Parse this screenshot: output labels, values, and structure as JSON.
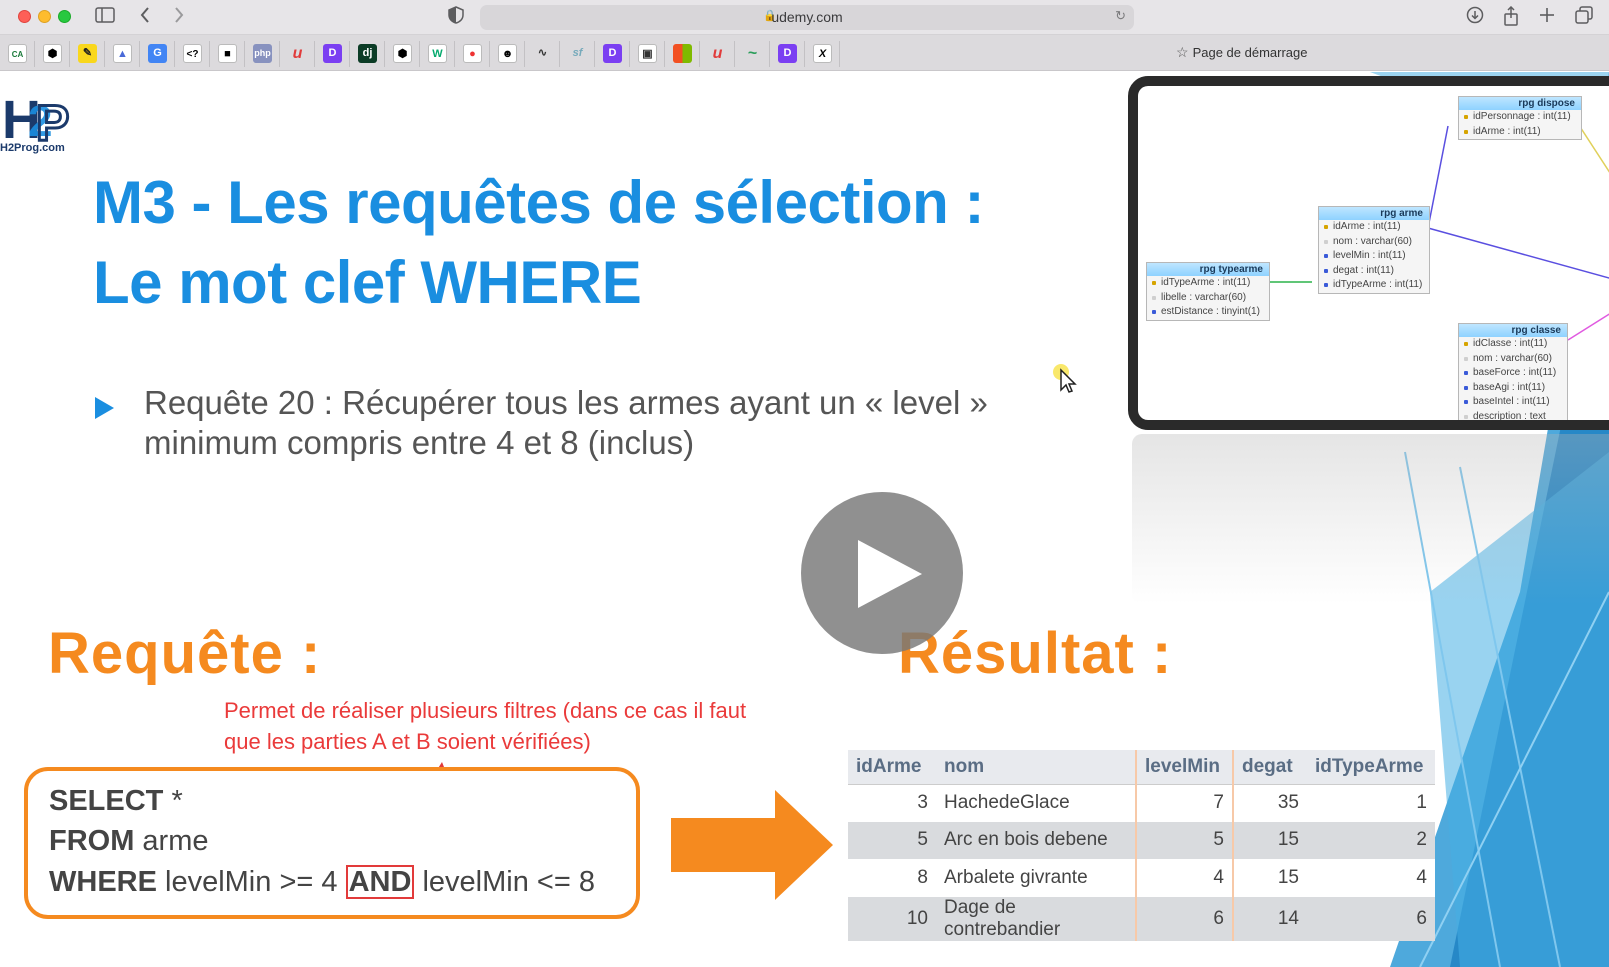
{
  "browser": {
    "url": "udemy.com",
    "start_page_label": "Page de démarrage",
    "favorites": [
      "CA",
      "codepen",
      "pencil",
      "uni",
      "G",
      "<?",
      "ceb",
      "php",
      "u",
      "D",
      "dj",
      "codepen",
      "W",
      "rec",
      "alien",
      "pulse",
      "sf",
      "D",
      "box",
      "ms",
      "u",
      "wave",
      "D",
      "X"
    ]
  },
  "slide": {
    "logo_text": "H2Prog.com",
    "title_line1": "M3 - Les requêtes de sélection :",
    "title_line2": "Le mot clef WHERE",
    "request_line1": "Requête 20 : Récupérer tous les armes ayant un « level »",
    "request_line2": "minimum compris entre 4 et 8 (inclus)",
    "requete_heading": "Requête :",
    "resultat_heading": "Résultat :",
    "note_line1": "Permet de réaliser plusieurs filtres (dans ce cas il faut",
    "note_line2": "que les parties A et B soient vérifiées)",
    "query": {
      "l1_kw": "SELECT",
      "l1_rest": " *",
      "l2_kw": "FROM",
      "l2_rest": " arme",
      "l3_kw": "WHERE",
      "l3_a": " levelMin >=  4",
      "l3_and": "AND",
      "l3_b": " levelMin <= 8"
    },
    "result": {
      "columns": [
        "idArme",
        "nom",
        "levelMin",
        "degat",
        "idTypeArme"
      ],
      "rows": [
        [
          "3",
          "HachedeGlace",
          "7",
          "35",
          "1"
        ],
        [
          "5",
          "Arc en bois debene",
          "5",
          "15",
          "2"
        ],
        [
          "8",
          "Arbalete givrante",
          "4",
          "15",
          "4"
        ],
        [
          "10",
          "Dage de contrebandier",
          "6",
          "14",
          "6"
        ]
      ]
    },
    "schema": {
      "typearme": {
        "title": "rpg typearme",
        "fields": [
          "idTypeArme : int(11)",
          "libelle : varchar(60)",
          "estDistance : tinyint(1)"
        ]
      },
      "arme": {
        "title": "rpg arme",
        "fields": [
          "idArme : int(11)",
          "nom : varchar(60)",
          "levelMin : int(11)",
          "degat : int(11)",
          "idTypeArme : int(11)"
        ]
      },
      "dispose": {
        "title": "rpg dispose",
        "fields": [
          "idPersonnage : int(11)",
          "idArme : int(11)"
        ]
      },
      "classe": {
        "title": "rpg classe",
        "fields": [
          "idClasse : int(11)",
          "nom : varchar(60)",
          "baseForce : int(11)",
          "baseAgi : int(11)",
          "baseIntel : int(11)",
          "description : text"
        ]
      }
    }
  },
  "colors": {
    "title_blue": "#1a8ee0",
    "accent_orange": "#f58a1f",
    "note_red": "#ea3a3a"
  }
}
